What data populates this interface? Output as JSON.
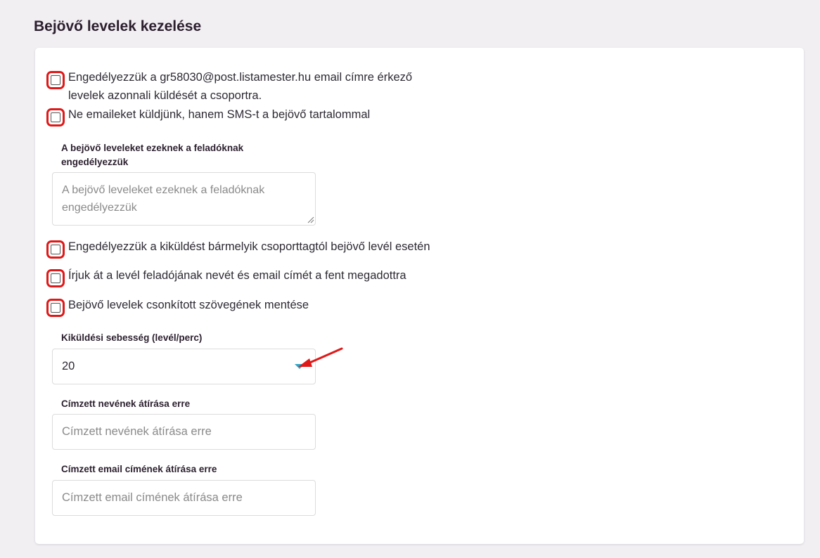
{
  "section_title": "Bejövő levelek kezelése",
  "checkboxes": [
    {
      "label": "Engedélyezzük a gr58030@post.listamester.hu email címre érkező levelek azonnali küldését a csoportra.",
      "checked": false
    },
    {
      "label": "Ne emaileket küldjünk, hanem SMS-t a bejövő tartalommal",
      "checked": false
    },
    {
      "label": "Engedélyezzük a kiküldést bármelyik csoporttagtól bejövő levél esetén",
      "checked": false
    },
    {
      "label": "Írjuk át a levél feladójának nevét és email címét a fent megadottra",
      "checked": false
    },
    {
      "label": "Bejövő levelek csonkított szövegének mentése",
      "checked": false
    }
  ],
  "allowed_senders": {
    "label": "A bejövő leveleket ezeknek a feladóknak engedélyezzük",
    "placeholder": "A bejövő leveleket ezeknek a feladóknak engedélyezzük",
    "value": ""
  },
  "send_rate": {
    "label": "Kiküldési sebesség (levél/perc)",
    "value": "20"
  },
  "recipient_name": {
    "label": "Címzett nevének átírása erre",
    "placeholder": "Címzett nevének átírása erre",
    "value": ""
  },
  "recipient_email": {
    "label": "Címzett email címének átírása erre",
    "placeholder": "Címzett email címének átírása erre",
    "value": ""
  },
  "colors": {
    "background": "#f2eff3",
    "card": "#ffffff",
    "highlight": "#e01818",
    "select_arrow": "#2aa6c8",
    "annotation_arrow": "#e01818"
  },
  "icons": {
    "select_arrow": "caret-down-icon",
    "annotation": "red-arrow-icon"
  }
}
